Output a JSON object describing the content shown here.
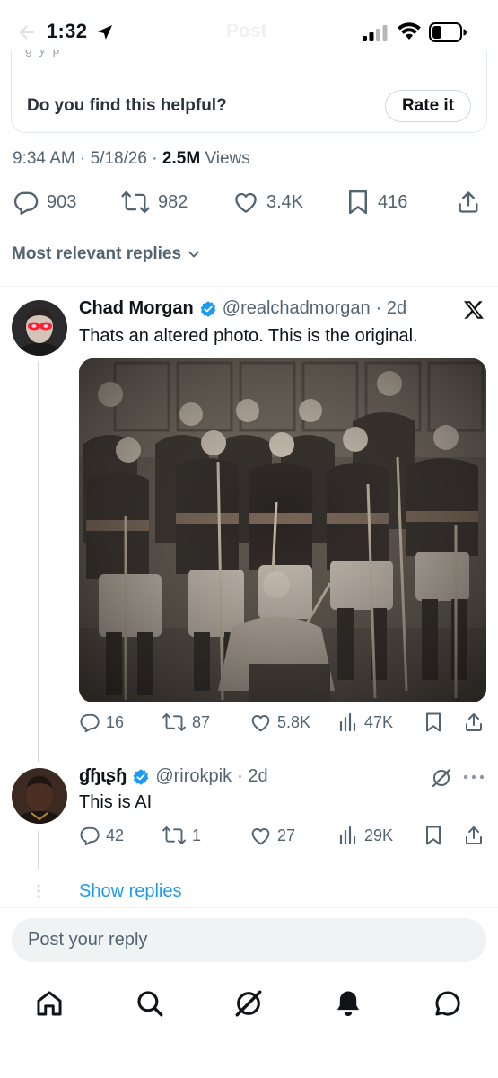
{
  "status_bar": {
    "time": "1:32"
  },
  "header_ghost": {
    "title": "Post"
  },
  "helpful_card": {
    "question": "Do you find this helpful?",
    "button": "Rate it"
  },
  "post_meta": {
    "time": "9:34 AM",
    "date": "5/18/26",
    "views_count": "2.5M",
    "views_label": "Views"
  },
  "post_stats": {
    "replies": "903",
    "reposts": "982",
    "likes": "3.4K",
    "bookmarks": "416"
  },
  "sort": {
    "label": "Most relevant replies"
  },
  "reply1": {
    "name": "Chad Morgan",
    "handle": "@realchadmorgan",
    "age": "· 2d",
    "text": "Thats an altered photo. This is the original.",
    "replies": "16",
    "reposts": "87",
    "likes": "5.8K",
    "views": "47K"
  },
  "reply2": {
    "name": "ɠɧɩʂɧ",
    "handle": "@rirokpik",
    "age": "· 2d",
    "text": "This is AI",
    "replies": "42",
    "reposts": "1",
    "likes": "27",
    "views": "29K"
  },
  "show_replies": "Show replies",
  "composer": {
    "placeholder": "Post your reply"
  },
  "colors": {
    "accent": "#1d9bf0",
    "muted": "#536471",
    "text": "#0f1419",
    "verified": "#1d9bf0"
  },
  "icons": [
    "location-arrow-icon",
    "signal-icon",
    "wifi-icon",
    "battery-icon",
    "reply-icon",
    "repost-icon",
    "like-icon",
    "bookmark-icon",
    "share-icon",
    "views-icon",
    "chevron-down-icon",
    "verified-badge-icon",
    "x-logo-icon",
    "grok-icon",
    "more-icon",
    "home-icon",
    "search-icon",
    "notifications-icon",
    "messages-icon"
  ]
}
